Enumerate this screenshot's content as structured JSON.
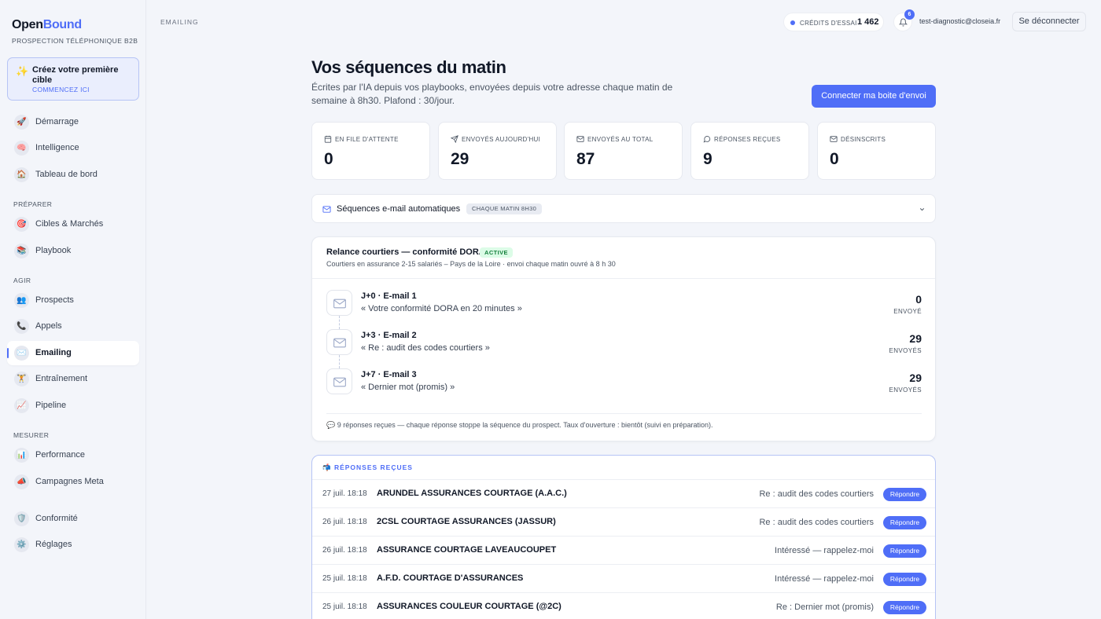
{
  "brand": {
    "part1": "Open",
    "part2": "Bound",
    "tagline": "Prospection téléphonique B2B"
  },
  "cta": {
    "title": "Créez votre première cible",
    "subtitle": "COMMENCEZ ICI"
  },
  "sections": {
    "prep": "Préparer",
    "agir": "Agir",
    "mesurer": "Mesurer"
  },
  "nav": [
    {
      "label": "Démarrage",
      "icon": "🚀"
    },
    {
      "label": "Intelligence",
      "icon": "🧠"
    },
    {
      "label": "Tableau de bord",
      "icon": "🏠"
    },
    {
      "label": "Cibles & Marchés",
      "icon": "🎯"
    },
    {
      "label": "Playbook",
      "icon": "📚"
    },
    {
      "label": "Prospects",
      "icon": "👥"
    },
    {
      "label": "Appels",
      "icon": "📞"
    },
    {
      "label": "Emailing",
      "icon": "✉️"
    },
    {
      "label": "Entraînement",
      "icon": "🏋️"
    },
    {
      "label": "Pipeline",
      "icon": "📈"
    },
    {
      "label": "Performance",
      "icon": "📊"
    },
    {
      "label": "Campagnes Meta",
      "icon": "📣"
    },
    {
      "label": "Conformité",
      "icon": "🛡️"
    },
    {
      "label": "Réglages",
      "icon": "⚙️"
    }
  ],
  "header": {
    "crumb": "EMAILING",
    "credits_label": "CRÉDITS D'ESSAI",
    "credits_value": "1 462",
    "notif_count": "6",
    "email": "test-diagnostic@closeia.fr",
    "logout": "Se déconnecter"
  },
  "page": {
    "title": "Vos séquences du matin",
    "subtitle": "Écrites par l'IA depuis vos playbooks, envoyées depuis votre adresse chaque matin de semaine à 8h30. Plafond : 30/jour.",
    "connect": "Connecter ma boite d'envoi"
  },
  "stats": [
    {
      "label": "En file d'attente",
      "value": "0",
      "icon": "calendar-icon"
    },
    {
      "label": "Envoyés aujourd'hui",
      "value": "29",
      "icon": "send-icon"
    },
    {
      "label": "Envoyés au total",
      "value": "87",
      "icon": "mail-icon"
    },
    {
      "label": "Réponses reçues",
      "value": "9",
      "icon": "chat-icon"
    },
    {
      "label": "Désinscrits",
      "value": "0",
      "icon": "mail-icon"
    }
  ],
  "seqbar": {
    "title": "Séquences e-mail automatiques",
    "tag": "CHAQUE MATIN 8H30"
  },
  "sequence": {
    "title": "Relance courtiers — conformité DORA",
    "status": "ACTIVE",
    "desc": "Courtiers en assurance 2-15 salariés – Pays de la Loire · envoi chaque matin ouvré à 8 h 30",
    "steps": [
      {
        "name": "J+0 · E-mail 1",
        "subject": "« Votre conformité DORA en 20 minutes »",
        "count": "0",
        "unit": "ENVOYÉ"
      },
      {
        "name": "J+3 · E-mail 2",
        "subject": "« Re : audit des codes courtiers »",
        "count": "29",
        "unit": "ENVOYÉS"
      },
      {
        "name": "J+7 · E-mail 3",
        "subject": "« Dernier mot (promis) »",
        "count": "29",
        "unit": "ENVOYÉS"
      }
    ],
    "footer": "💬 9 réponses reçues — chaque réponse stoppe la séquence du prospect. Taux d'ouverture : bientôt (suivi en préparation)."
  },
  "replies": {
    "header": "📬 RÉPONSES REÇUES",
    "button": "Répondre",
    "rows": [
      {
        "date": "27 juil. 18:18",
        "company": "ARUNDEL ASSURANCES COURTAGE (A.A.C.)",
        "subject": "Re : audit des codes courtiers"
      },
      {
        "date": "26 juil. 18:18",
        "company": "2CSL COURTAGE ASSURANCES (JASSUR)",
        "subject": "Re : audit des codes courtiers"
      },
      {
        "date": "26 juil. 18:18",
        "company": "ASSURANCE COURTAGE LAVEAUCOUPET",
        "subject": "Intéressé — rappelez-moi"
      },
      {
        "date": "25 juil. 18:18",
        "company": "A.F.D. COURTAGE D'ASSURANCES",
        "subject": "Intéressé — rappelez-moi"
      },
      {
        "date": "25 juil. 18:18",
        "company": "ASSURANCES COULEUR COURTAGE (@2C)",
        "subject": "Re : Dernier mot (promis)"
      }
    ]
  },
  "colors": {
    "accent": "#4f6ef7",
    "active_green": "#15803d",
    "bg": "#f3f5fa"
  }
}
